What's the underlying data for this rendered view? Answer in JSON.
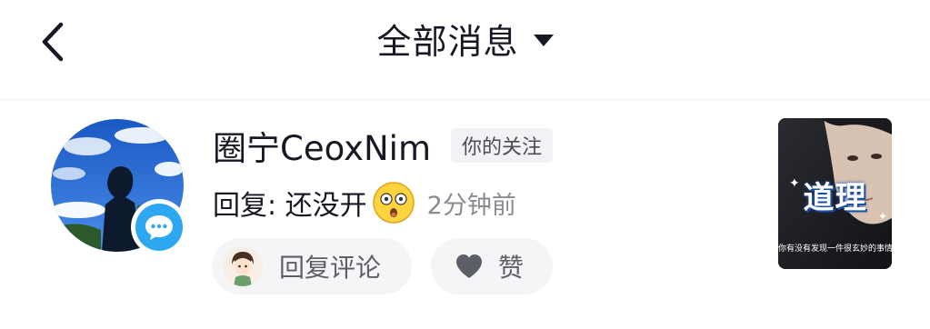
{
  "header": {
    "title": "全部消息",
    "back_icon": "chevron-left-icon",
    "dropdown_icon": "caret-down-icon"
  },
  "message": {
    "username": "圈宁CeoxNim",
    "tag": "你的关注",
    "reply_text": "回复: 还没开",
    "emoji": "astonished-face-emoji",
    "time": "2分钟前",
    "actions": {
      "reply_label": "回复评论",
      "like_label": "赞"
    },
    "thumbnail": {
      "title": "道理",
      "caption": "你有没有发现一件很玄妙的事情"
    },
    "badge_color": "#2ea7f1"
  }
}
